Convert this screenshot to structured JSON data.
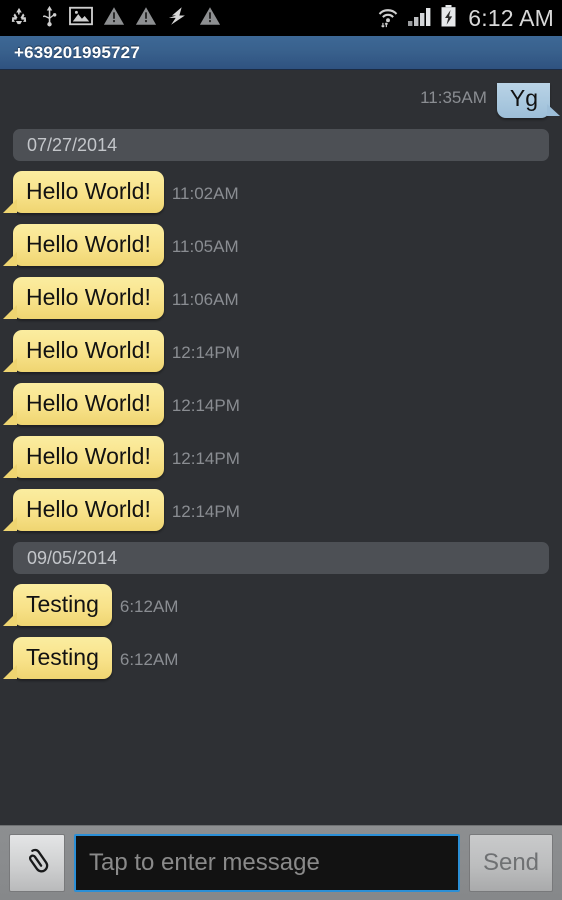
{
  "statusbar": {
    "icons": [
      {
        "name": "recycle-icon"
      },
      {
        "name": "usb-icon"
      },
      {
        "name": "image-icon"
      },
      {
        "name": "warning-icon"
      },
      {
        "name": "warning-icon"
      },
      {
        "name": "sync-lightning-icon"
      },
      {
        "name": "warning-icon"
      }
    ],
    "right_icons": [
      {
        "name": "wifi-data-icon"
      },
      {
        "name": "signal-bars-icon"
      },
      {
        "name": "battery-charging-icon"
      }
    ],
    "clock": "6:12 AM"
  },
  "titlebar": {
    "title": "+639201995727",
    "accent": "#3d6896"
  },
  "thread": {
    "top_partial": {
      "timestamp": "11:35AM",
      "text": "Yg",
      "direction": "outgoing"
    },
    "groups": [
      {
        "date": "07/27/2014",
        "messages": [
          {
            "text": "Hello World!",
            "timestamp": "11:02AM",
            "direction": "incoming"
          },
          {
            "text": "Hello World!",
            "timestamp": "11:05AM",
            "direction": "incoming"
          },
          {
            "text": "Hello World!",
            "timestamp": "11:06AM",
            "direction": "incoming"
          },
          {
            "text": "Hello World!",
            "timestamp": "12:14PM",
            "direction": "incoming"
          },
          {
            "text": "Hello World!",
            "timestamp": "12:14PM",
            "direction": "incoming"
          },
          {
            "text": "Hello World!",
            "timestamp": "12:14PM",
            "direction": "incoming"
          },
          {
            "text": "Hello World!",
            "timestamp": "12:14PM",
            "direction": "incoming"
          }
        ]
      },
      {
        "date": "09/05/2014",
        "messages": [
          {
            "text": "Testing",
            "timestamp": "6:12AM",
            "direction": "incoming"
          },
          {
            "text": "Testing",
            "timestamp": "6:12AM",
            "direction": "incoming"
          }
        ]
      }
    ],
    "colors": {
      "background": "#2e3034",
      "incoming_bubble": "#f8e28a",
      "outgoing_bubble": "#a8c7de",
      "timestamp_text": "#8a8d92",
      "date_bar": "#4d5055"
    }
  },
  "compose": {
    "attach_icon": "paperclip-icon",
    "input_value": "",
    "input_placeholder": "Tap to enter message",
    "send_label": "Send",
    "focus_color": "#2b8fd6"
  }
}
